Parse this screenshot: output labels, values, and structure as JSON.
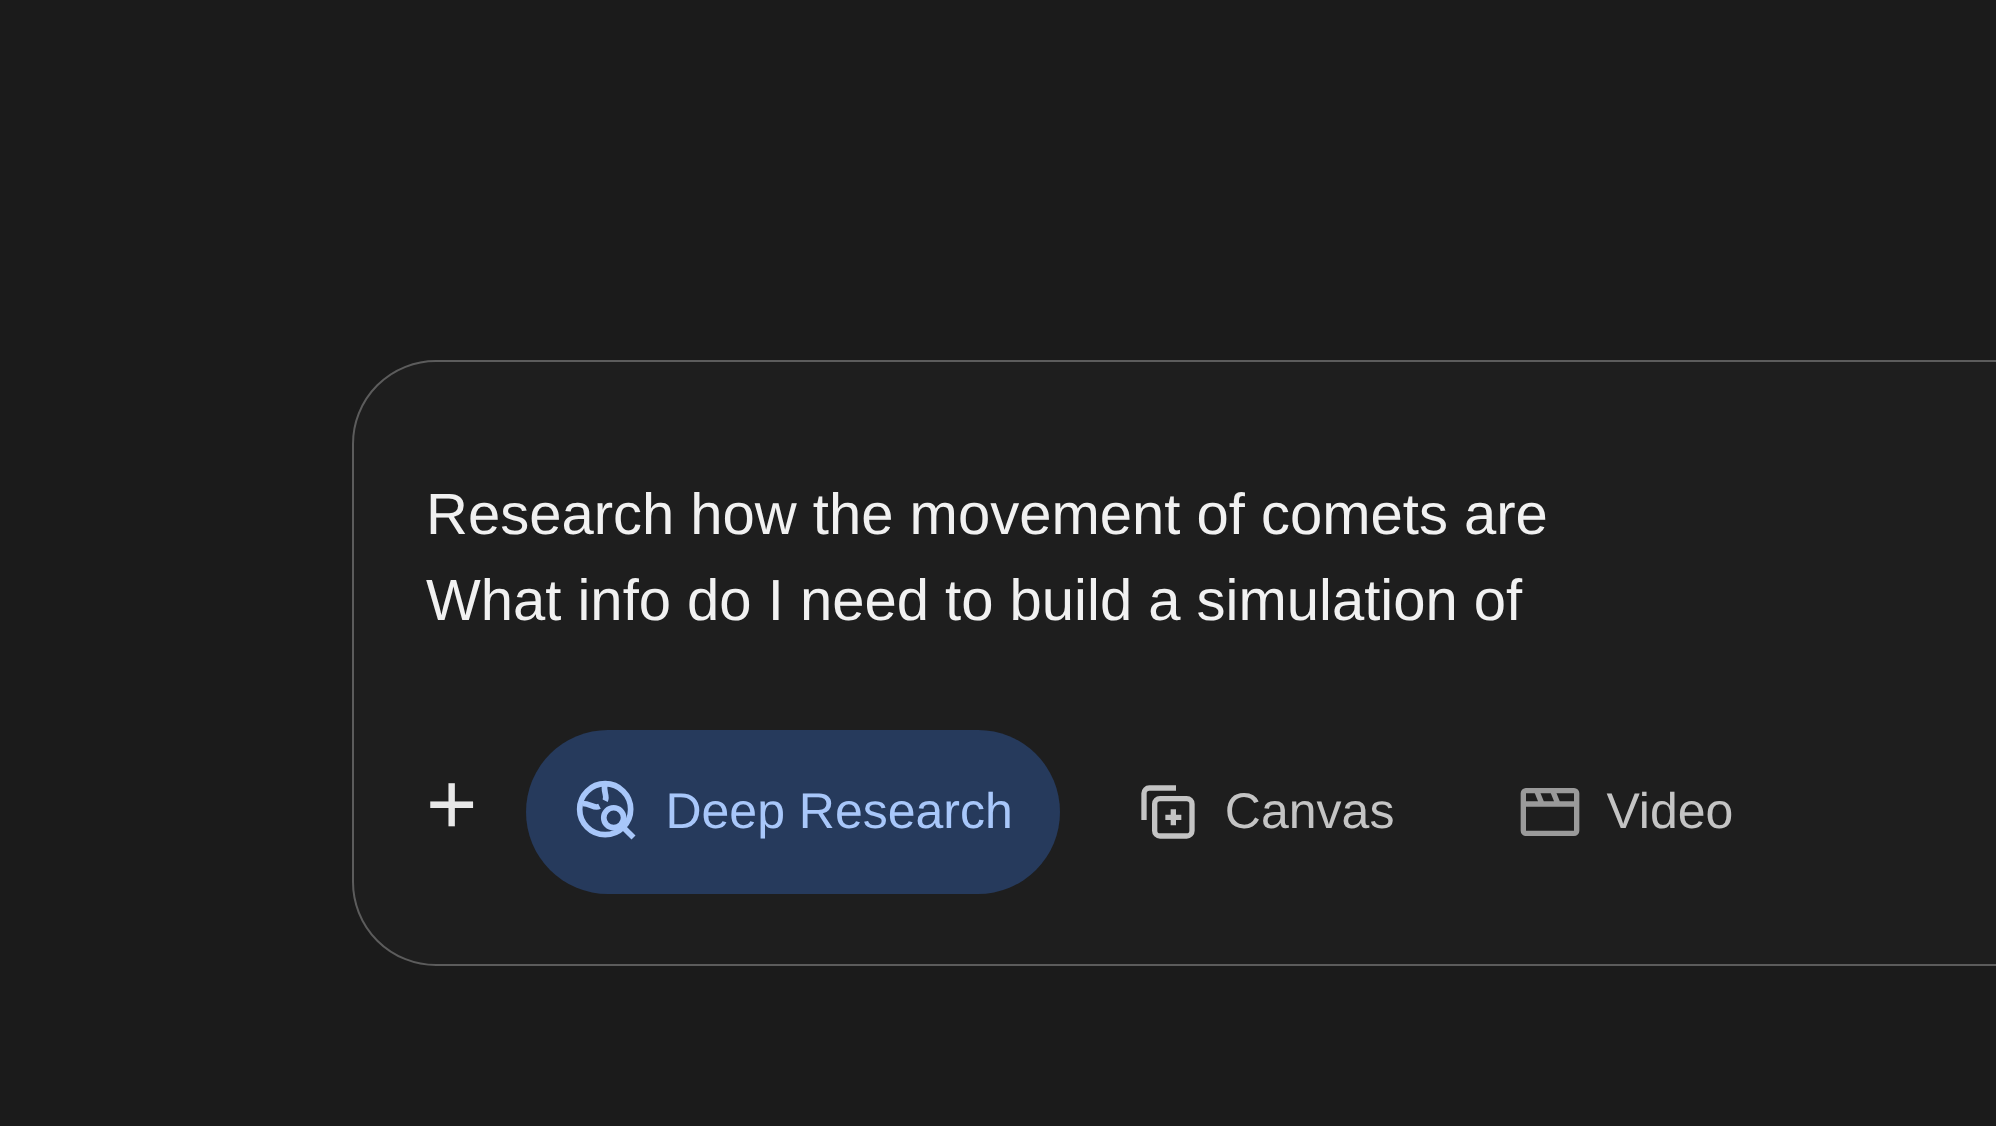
{
  "prompt": {
    "lines": [
      "Research how the movement of comets are",
      "What info do I need to build a simulation of"
    ]
  },
  "tools": [
    {
      "kind": "add",
      "label": "+"
    },
    {
      "kind": "deep-research",
      "label": "Deep Research",
      "selected": true
    },
    {
      "kind": "canvas",
      "label": "Canvas",
      "selected": false
    },
    {
      "kind": "video",
      "label": "Video",
      "selected": false
    }
  ]
}
